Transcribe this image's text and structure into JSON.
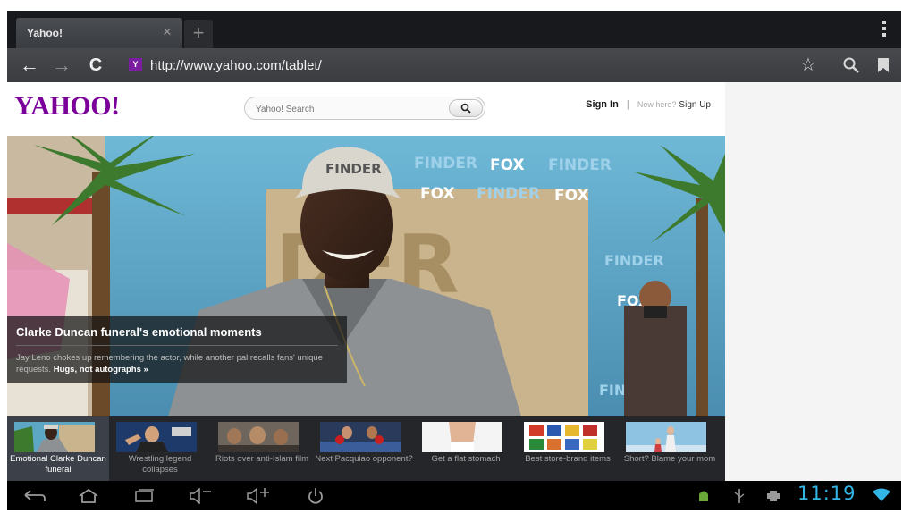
{
  "browser": {
    "tab_title": "Yahoo!",
    "tab_close_icon": "×",
    "new_tab_icon": "+",
    "url": "http://www.yahoo.com/tablet/",
    "favicon_letter": "Y",
    "back_icon": "←",
    "forward_icon": "→",
    "reload_icon": "C",
    "star_icon": "☆",
    "search_icon": "⚲"
  },
  "yahoo": {
    "logo": "YAHOO!",
    "search_placeholder": "Yahoo! Search",
    "search_button_icon": "🔍",
    "sign_in": "Sign In",
    "separator": "|",
    "new_here": "New here?",
    "sign_up": "Sign Up"
  },
  "hero": {
    "title": "Clarke Duncan funeral's emotional moments",
    "text": "Jay Leno chokes up remembering the actor, while another pal recalls fans' unique requests.",
    "link": "Hugs, not autographs »",
    "signage": [
      "FINDER",
      "FOX"
    ]
  },
  "thumbs": [
    {
      "label": "Emotional Clarke Duncan funeral",
      "active": true
    },
    {
      "label": "Wrestling legend collapses",
      "active": false
    },
    {
      "label": "Riots over anti-Islam film",
      "active": false
    },
    {
      "label": "Next Pacquiao opponent?",
      "active": false
    },
    {
      "label": "Get a flat stomach",
      "active": false
    },
    {
      "label": "Best store-brand items",
      "active": false
    },
    {
      "label": "Short? Blame your mom",
      "active": false
    }
  ],
  "system": {
    "clock": "11:19"
  },
  "colors": {
    "yahoo_purple": "#7b0099",
    "clock_blue": "#33b5e5",
    "toolbar": "#3a3c40"
  }
}
